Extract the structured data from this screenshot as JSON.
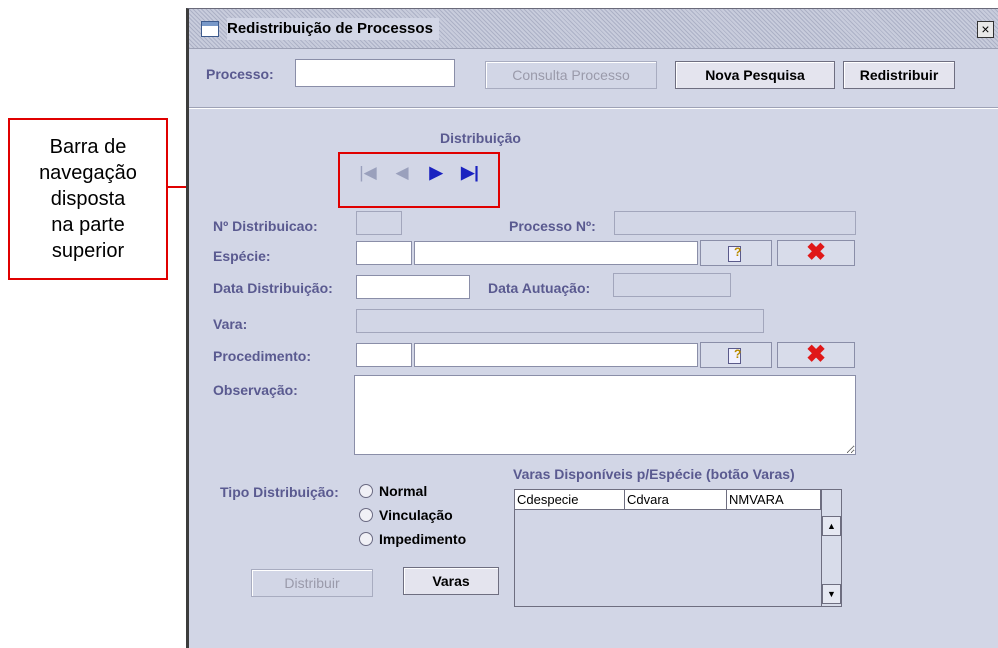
{
  "annotation": {
    "text": "Barra de\nnavegação\ndisposta\nna parte\nsuperior"
  },
  "window": {
    "title": "Redistribuição de Processos",
    "close_glyph": "×"
  },
  "toolbar": {
    "processo_label": "Processo:",
    "processo_value": "",
    "consulta_label": "Consulta Processo",
    "nova_label": "Nova Pesquisa",
    "redistribuir_label": "Redistribuir"
  },
  "section": {
    "title": "Distribuição"
  },
  "nav": {
    "first": "|◀",
    "prev": "◀",
    "next": "▶",
    "last": "▶|"
  },
  "form": {
    "n_distribuicao_label": "Nº Distribuicao:",
    "processo_n_label": "Processo Nº:",
    "especie_label": "Espécie:",
    "data_distribuicao_label": "Data Distribuição:",
    "data_autuacao_label": "Data Autuação:",
    "vara_label": "Vara:",
    "procedimento_label": "Procedimento:",
    "observacao_label": "Observação:",
    "tipo_label": "Tipo Distribuição:",
    "tipo_options": [
      "Normal",
      "Vinculação",
      "Impedimento"
    ]
  },
  "buttons": {
    "distribuir_label": "Distribuir",
    "varas_label": "Varas"
  },
  "varas_panel": {
    "title": "Varas Disponíveis p/Espécie (botão Varas)",
    "columns": [
      "Cdespecie",
      "Cdvara",
      "NMVARA"
    ]
  },
  "colors": {
    "window_bg": "#d2d6e6",
    "label": "#5a5a90",
    "annotation": "#e00000",
    "nav_active": "#1a22c0"
  },
  "icons": {
    "lookup": "help-lookup-icon",
    "clear": "red-x-icon"
  }
}
